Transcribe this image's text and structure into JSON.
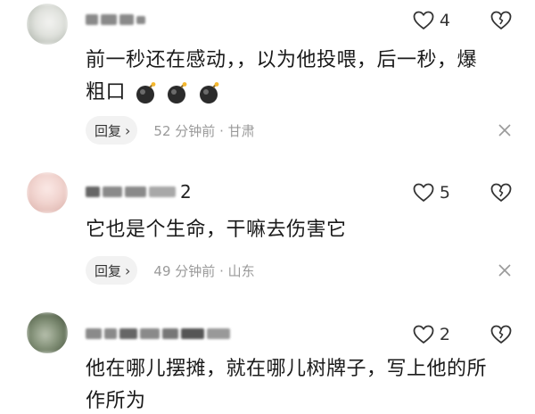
{
  "comments": [
    {
      "like_count": "4",
      "text_lines": [
        "前一秒还在感动，，以为他投喂，后一秒，爆",
        "粗口"
      ],
      "reply_label": "回复",
      "time": "52 分钟前",
      "location": "甘肃",
      "avatar_color": "#d9dcd6"
    },
    {
      "username_tail": "2",
      "like_count": "5",
      "text_lines": [
        "它也是个生命，干嘛去伤害它"
      ],
      "reply_label": "回复",
      "time": "49 分钟前",
      "location": "山东",
      "avatar_color": "#f0d6d2"
    },
    {
      "like_count": "2",
      "text_lines": [
        "他在哪儿摆摊，就在哪儿树牌子，写上他的所",
        "作所为"
      ],
      "avatar_color": "#7c8a72"
    }
  ],
  "separator": "·",
  "icons": {
    "like": "heart-outline-icon",
    "dislike": "broken-heart-icon",
    "close": "close-icon",
    "reply_chevron": "chevron-right-icon",
    "emoji": "bomb-emoji-icon"
  },
  "colors": {
    "meta_text": "#9a9a9a",
    "reply_bg": "#f2f2f2"
  }
}
